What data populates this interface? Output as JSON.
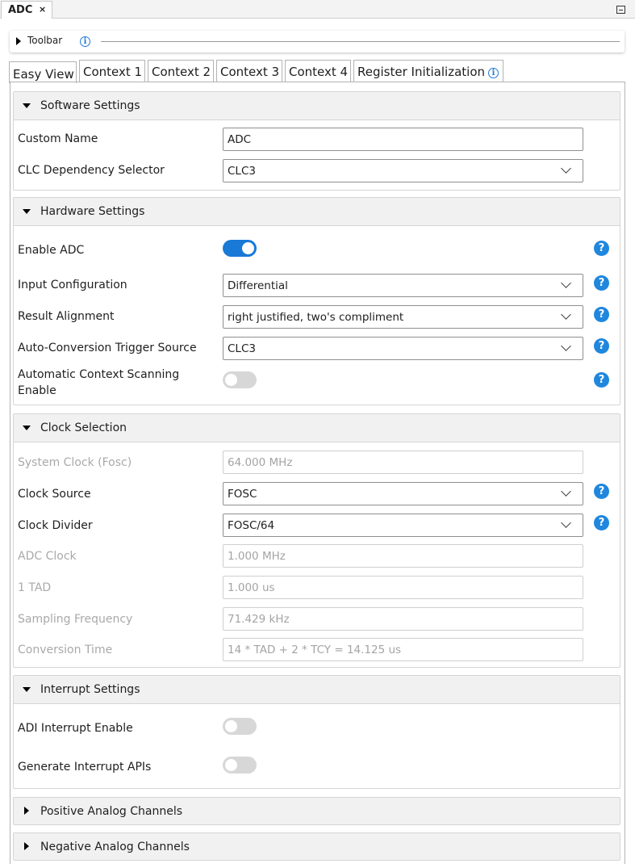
{
  "top_tab": {
    "label": "ADC",
    "close": "×"
  },
  "toolbar": {
    "label": "Toolbar",
    "info": "i"
  },
  "view_tabs": [
    {
      "label": "Easy View"
    },
    {
      "label": "Context 1"
    },
    {
      "label": "Context 2"
    },
    {
      "label": "Context 3"
    },
    {
      "label": "Context 4"
    },
    {
      "label": "Register Initialization",
      "info": "i"
    }
  ],
  "software_settings": {
    "title": "Software Settings",
    "custom_name": {
      "label": "Custom Name",
      "value": "ADC"
    },
    "clc_dependency": {
      "label": "CLC Dependency Selector",
      "value": "CLC3"
    }
  },
  "hardware_settings": {
    "title": "Hardware Settings",
    "enable_adc": {
      "label": "Enable ADC",
      "on": true
    },
    "input_configuration": {
      "label": "Input Configuration",
      "value": "Differential"
    },
    "result_alignment": {
      "label": "Result Alignment",
      "value": "right justified, two's compliment"
    },
    "trigger_source": {
      "label": "Auto-Conversion Trigger Source",
      "value": "CLC3"
    },
    "context_scanning": {
      "label_line1": "Automatic Context Scanning",
      "label_line2": "Enable",
      "on": false
    }
  },
  "clock_selection": {
    "title": "Clock Selection",
    "system_clock": {
      "label": "System Clock (Fosc)",
      "value": "64.000 MHz"
    },
    "clock_source": {
      "label": "Clock Source",
      "value": "FOSC"
    },
    "clock_divider": {
      "label": "Clock Divider",
      "value": "FOSC/64"
    },
    "adc_clock": {
      "label": "ADC Clock",
      "value": "1.000 MHz"
    },
    "tad": {
      "label": "1 TAD",
      "value": "1.000 us"
    },
    "sampling_frequency": {
      "label": "Sampling Frequency",
      "value": "71.429 kHz"
    },
    "conversion_time": {
      "label": "Conversion Time",
      "value": "14 * TAD + 2 * TCY = 14.125 us"
    }
  },
  "interrupt_settings": {
    "title": "Interrupt Settings",
    "adi_interrupt": {
      "label": "ADI Interrupt Enable",
      "on": false
    },
    "generate_apis": {
      "label": "Generate Interrupt APIs",
      "on": false
    }
  },
  "positive_channels": {
    "title": "Positive Analog Channels"
  },
  "negative_channels": {
    "title": "Negative Analog Channels"
  },
  "help_glyph": "?",
  "colors": {
    "accent": "#1979d6",
    "help": "#1f87de",
    "header_bg": "#f1f1f1"
  }
}
